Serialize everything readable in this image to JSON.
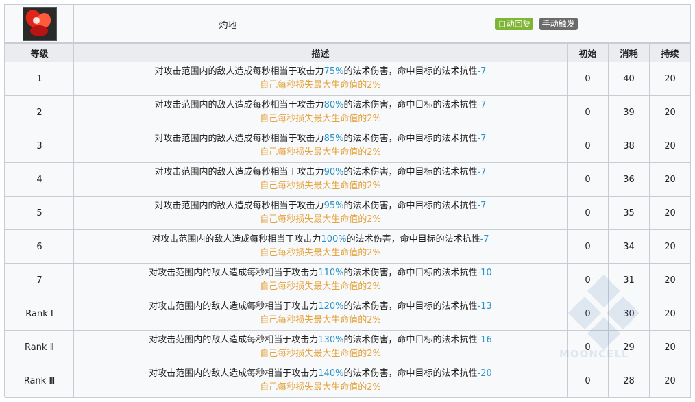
{
  "skill": {
    "icon": "fire-skill-icon",
    "name": "灼地",
    "tags": [
      {
        "label": "自动回复",
        "color": "#7fb536"
      },
      {
        "label": "手动触发",
        "color": "#6b6b6b"
      }
    ]
  },
  "table": {
    "headers": {
      "level": "等级",
      "description": "描述",
      "initial": "初始",
      "cost": "消耗",
      "duration": "持续"
    },
    "rows": [
      {
        "level": "1",
        "desc_prefix": "对攻击范围内的敌人造成每秒相当于攻击力",
        "pct": "75%",
        "desc_mid": "的法术伤害，命中目标的法术抗性",
        "res": "-7",
        "desc_line2": "自己每秒损失最大生命值的2%",
        "initial": "0",
        "cost": "40",
        "duration": "20"
      },
      {
        "level": "2",
        "desc_prefix": "对攻击范围内的敌人造成每秒相当于攻击力",
        "pct": "80%",
        "desc_mid": "的法术伤害，命中目标的法术抗性",
        "res": "-7",
        "desc_line2": "自己每秒损失最大生命值的2%",
        "initial": "0",
        "cost": "39",
        "duration": "20"
      },
      {
        "level": "3",
        "desc_prefix": "对攻击范围内的敌人造成每秒相当于攻击力",
        "pct": "85%",
        "desc_mid": "的法术伤害，命中目标的法术抗性",
        "res": "-7",
        "desc_line2": "自己每秒损失最大生命值的2%",
        "initial": "0",
        "cost": "38",
        "duration": "20"
      },
      {
        "level": "4",
        "desc_prefix": "对攻击范围内的敌人造成每秒相当于攻击力",
        "pct": "90%",
        "desc_mid": "的法术伤害，命中目标的法术抗性",
        "res": "-7",
        "desc_line2": "自己每秒损失最大生命值的2%",
        "initial": "0",
        "cost": "36",
        "duration": "20"
      },
      {
        "level": "5",
        "desc_prefix": "对攻击范围内的敌人造成每秒相当于攻击力",
        "pct": "95%",
        "desc_mid": "的法术伤害，命中目标的法术抗性",
        "res": "-7",
        "desc_line2": "自己每秒损失最大生命值的2%",
        "initial": "0",
        "cost": "35",
        "duration": "20"
      },
      {
        "level": "6",
        "desc_prefix": "对攻击范围内的敌人造成每秒相当于攻击力",
        "pct": "100%",
        "desc_mid": "的法术伤害，命中目标的法术抗性",
        "res": "-7",
        "desc_line2": "自己每秒损失最大生命值的2%",
        "initial": "0",
        "cost": "34",
        "duration": "20"
      },
      {
        "level": "7",
        "desc_prefix": "对攻击范围内的敌人造成每秒相当于攻击力",
        "pct": "110%",
        "desc_mid": "的法术伤害，命中目标的法术抗性",
        "res": "-10",
        "desc_line2": "自己每秒损失最大生命值的2%",
        "initial": "0",
        "cost": "31",
        "duration": "20"
      },
      {
        "level": "Rank Ⅰ",
        "desc_prefix": "对攻击范围内的敌人造成每秒相当于攻击力",
        "pct": "120%",
        "desc_mid": "的法术伤害，命中目标的法术抗性",
        "res": "-13",
        "desc_line2": "自己每秒损失最大生命值的2%",
        "initial": "0",
        "cost": "30",
        "duration": "20"
      },
      {
        "level": "Rank Ⅱ",
        "desc_prefix": "对攻击范围内的敌人造成每秒相当于攻击力",
        "pct": "130%",
        "desc_mid": "的法术伤害，命中目标的法术抗性",
        "res": "-16",
        "desc_line2": "自己每秒损失最大生命值的2%",
        "initial": "0",
        "cost": "29",
        "duration": "20"
      },
      {
        "level": "Rank Ⅲ",
        "desc_prefix": "对攻击范围内的敌人造成每秒相当于攻击力",
        "pct": "140%",
        "desc_mid": "的法术伤害，命中目标的法术抗性",
        "res": "-20",
        "desc_line2": "自己每秒损失最大生命值的2%",
        "initial": "0",
        "cost": "28",
        "duration": "20"
      }
    ]
  },
  "watermark": {
    "text": "MOONCELL"
  },
  "colors": {
    "highlight_blue": "#2a94c8",
    "highlight_orange": "#e6a23c",
    "header_bg": "#eaecf0",
    "border": "#c9ccd4"
  }
}
